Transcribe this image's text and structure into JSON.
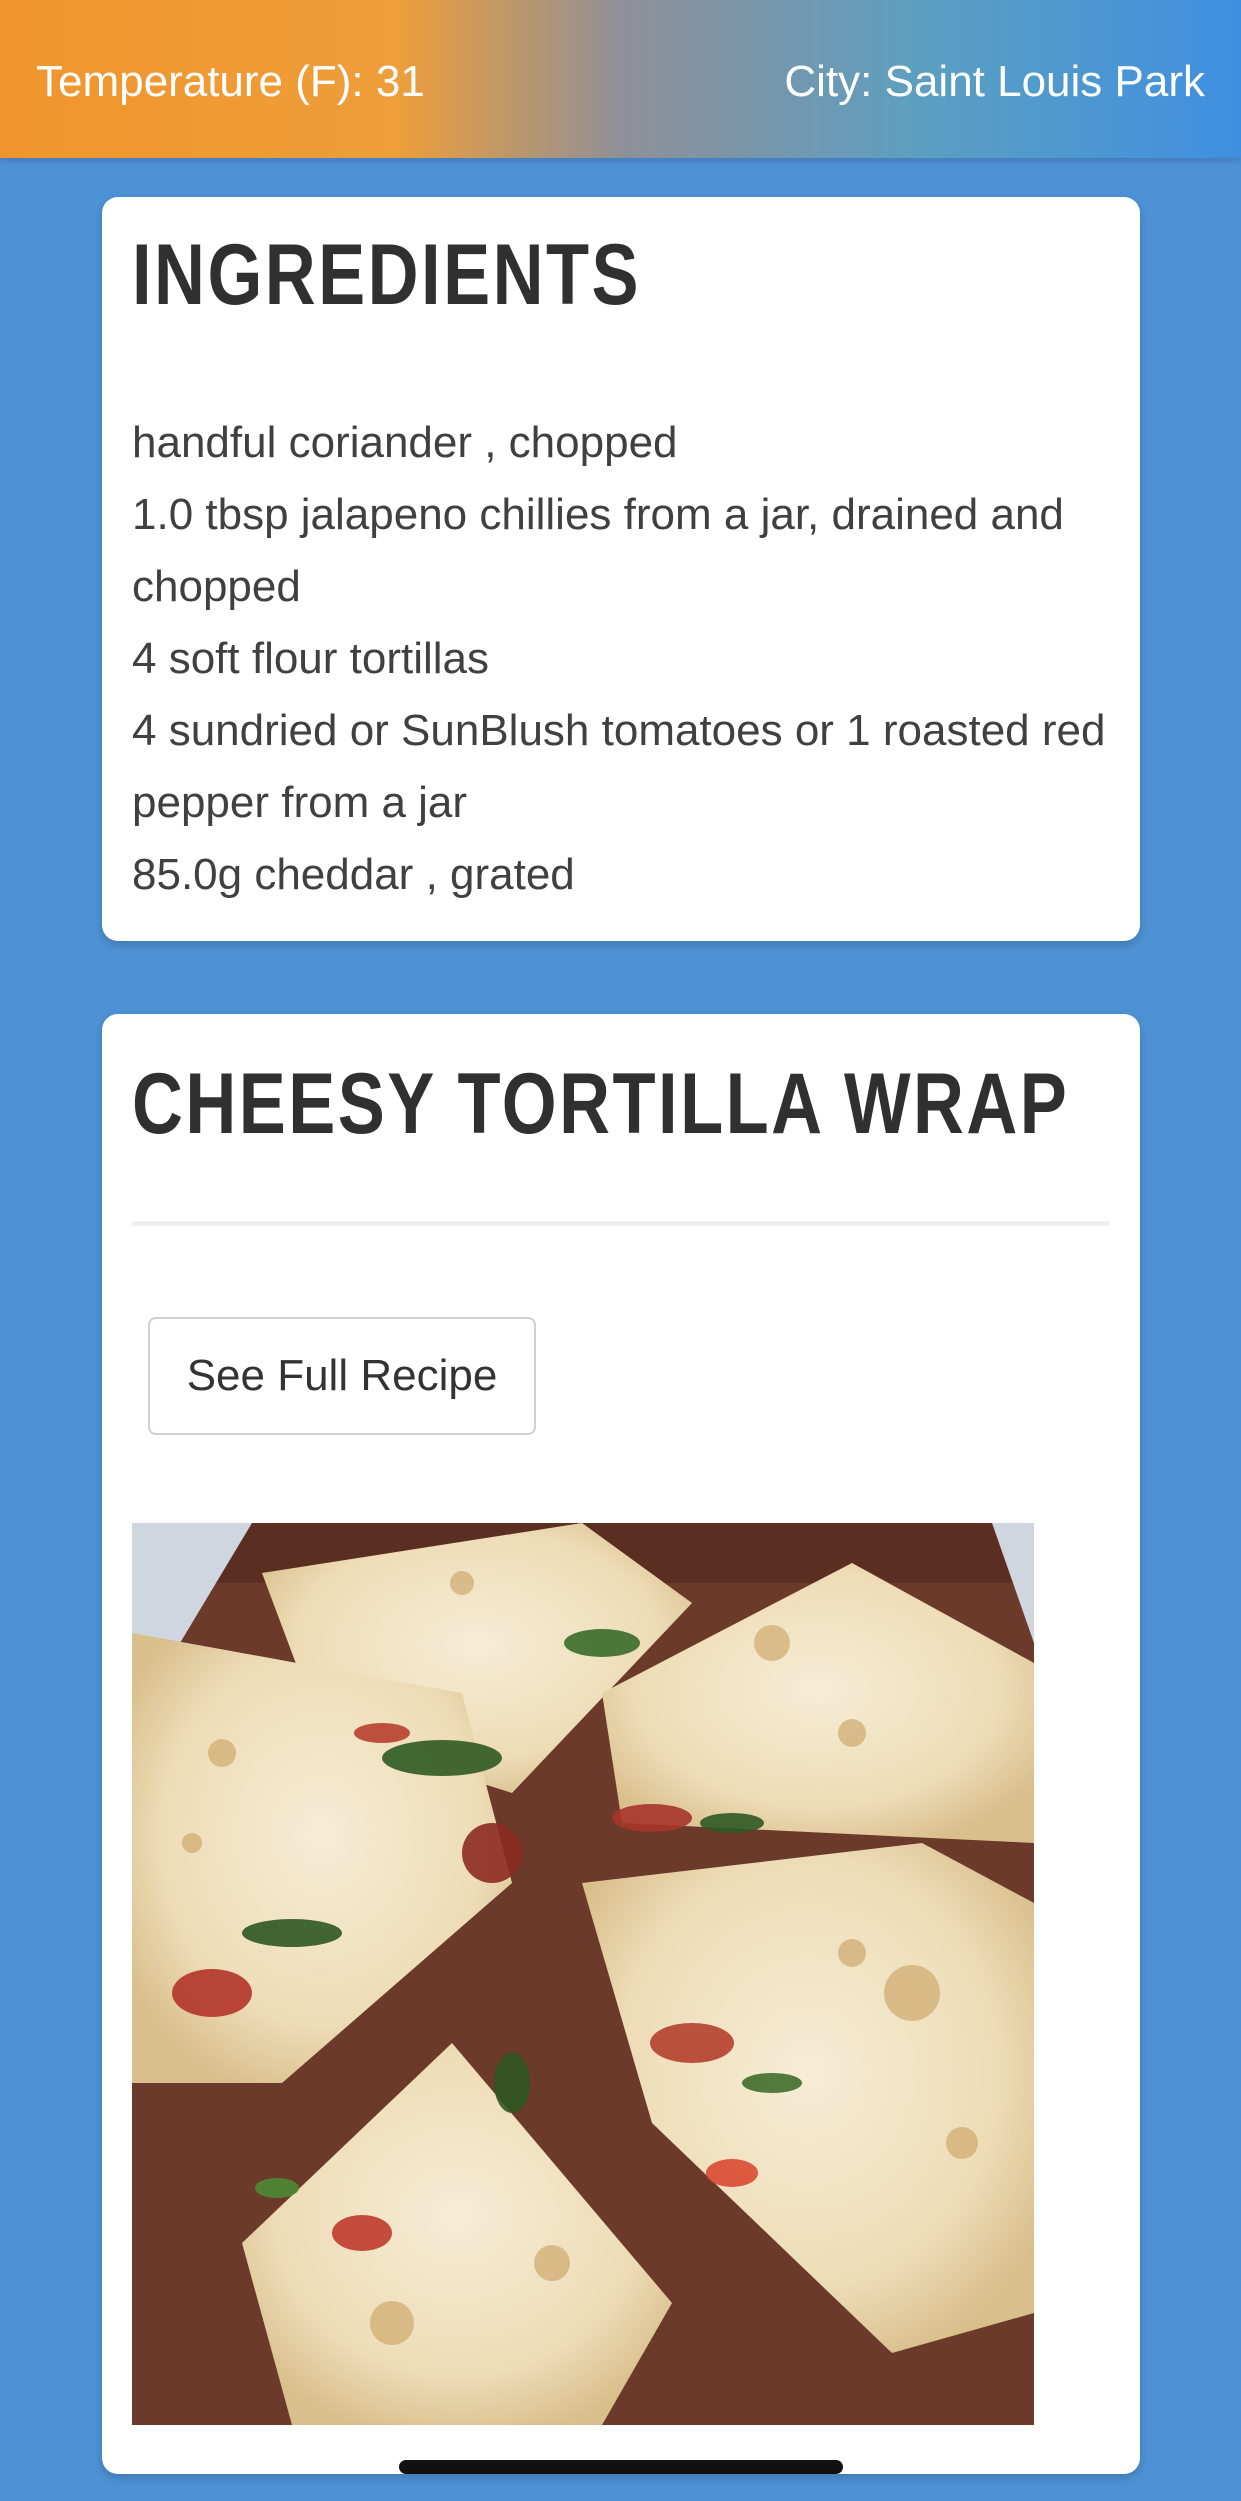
{
  "header": {
    "temperature": "Temperature (F): 31",
    "city": "City: Saint Louis Park"
  },
  "ingredients_card": {
    "title": "INGREDIENTS",
    "items": [
      "handful coriander , chopped",
      "1.0 tbsp jalapeno chillies from a jar, drained and chopped",
      "4 soft flour tortillas",
      "4 sundried or SunBlush tomatoes or 1 roasted red pepper from a jar",
      "85.0g cheddar , grated"
    ]
  },
  "recipe_card": {
    "title": "CHEESY TORTILLA WRAP",
    "button_label": "See Full Recipe",
    "image_icon": "food-photo"
  },
  "colors": {
    "page_background": "#4e92d6",
    "header_gradient_start": "#f0952c",
    "header_gradient_end": "#3f8fe0",
    "card_background": "#ffffff",
    "heading_text": "#303030"
  }
}
